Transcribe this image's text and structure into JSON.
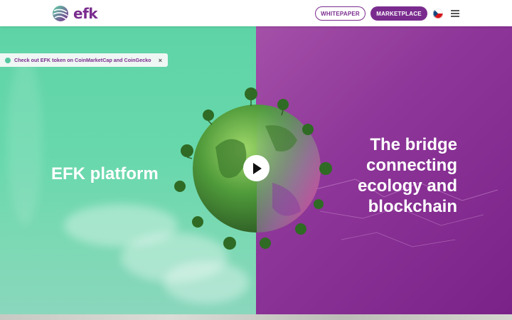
{
  "header": {
    "logo_text": "efk",
    "whitepaper_label": "WHITEPAPER",
    "marketplace_label": "MARKETPLACE",
    "language_flag": "czech-flag-icon",
    "menu_icon": "hamburger-menu-icon"
  },
  "notice": {
    "text": "Check out EFK token on CoinMarketCap and CoinGecko",
    "close_label": "×"
  },
  "hero": {
    "left_title": "EFK platform",
    "right_title": "The bridge\nconnecting\necology and\nblockchain",
    "play_icon": "play-icon"
  },
  "colors": {
    "brand_purple": "#7a2c8e",
    "left_green": "#5ed4a6",
    "right_purple": "#8e3699"
  }
}
